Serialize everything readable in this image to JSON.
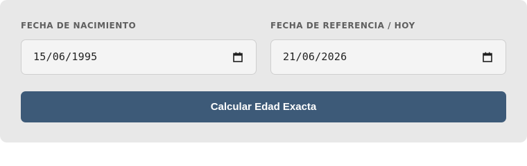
{
  "form": {
    "birth_date": {
      "label": "FECHA DE NACIMIENTO",
      "value": "15/06/1995",
      "icon": "calendar-icon"
    },
    "reference_date": {
      "label": "FECHA DE REFERENCIA / HOY",
      "value": "21/06/2026",
      "icon": "calendar-icon"
    },
    "submit_label": "Calcular Edad Exacta"
  },
  "colors": {
    "card_background": "#e8e8e8",
    "input_background": "#f4f4f4",
    "button_background": "#3d5a78",
    "button_text": "#ffffff",
    "label_text": "#5f5f5f"
  }
}
